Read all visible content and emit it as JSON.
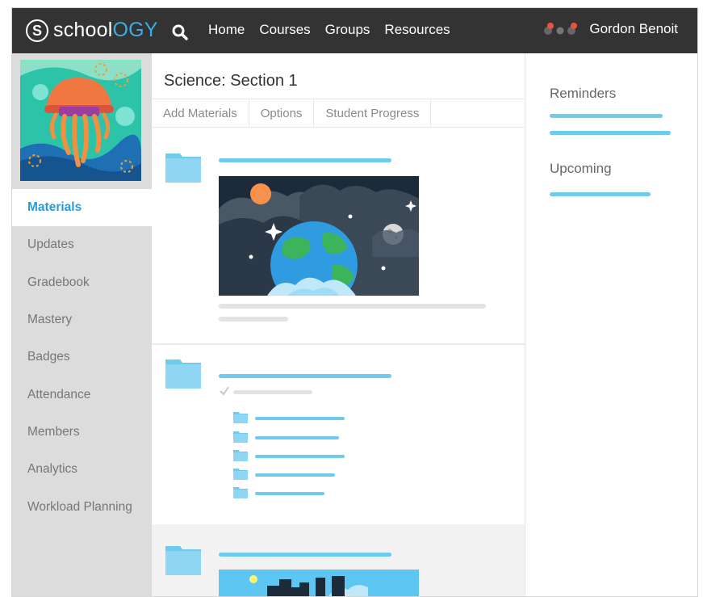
{
  "header": {
    "logo_text": "schoology",
    "nav": [
      "Home",
      "Courses",
      "Groups",
      "Resources"
    ],
    "user_name": "Gordon Benoit",
    "brand_accent": "#3aaee0"
  },
  "sidebar": {
    "items": [
      {
        "label": "Materials",
        "active": true
      },
      {
        "label": "Updates"
      },
      {
        "label": "Gradebook"
      },
      {
        "label": "Mastery"
      },
      {
        "label": "Badges"
      },
      {
        "label": "Attendance"
      },
      {
        "label": "Members"
      },
      {
        "label": "Analytics"
      },
      {
        "label": "Workload Planning"
      }
    ]
  },
  "main": {
    "course_title": "Science: Section 1",
    "tabs": [
      "Add Materials",
      "Options",
      "Student Progress"
    ]
  },
  "right": {
    "reminders_title": "Reminders",
    "upcoming_title": "Upcoming"
  },
  "colors": {
    "topbar": "#333333",
    "accent_blue": "#6fcaf0",
    "active_link": "#2b9bd8",
    "sidebar_bg": "#dcdcdc"
  }
}
